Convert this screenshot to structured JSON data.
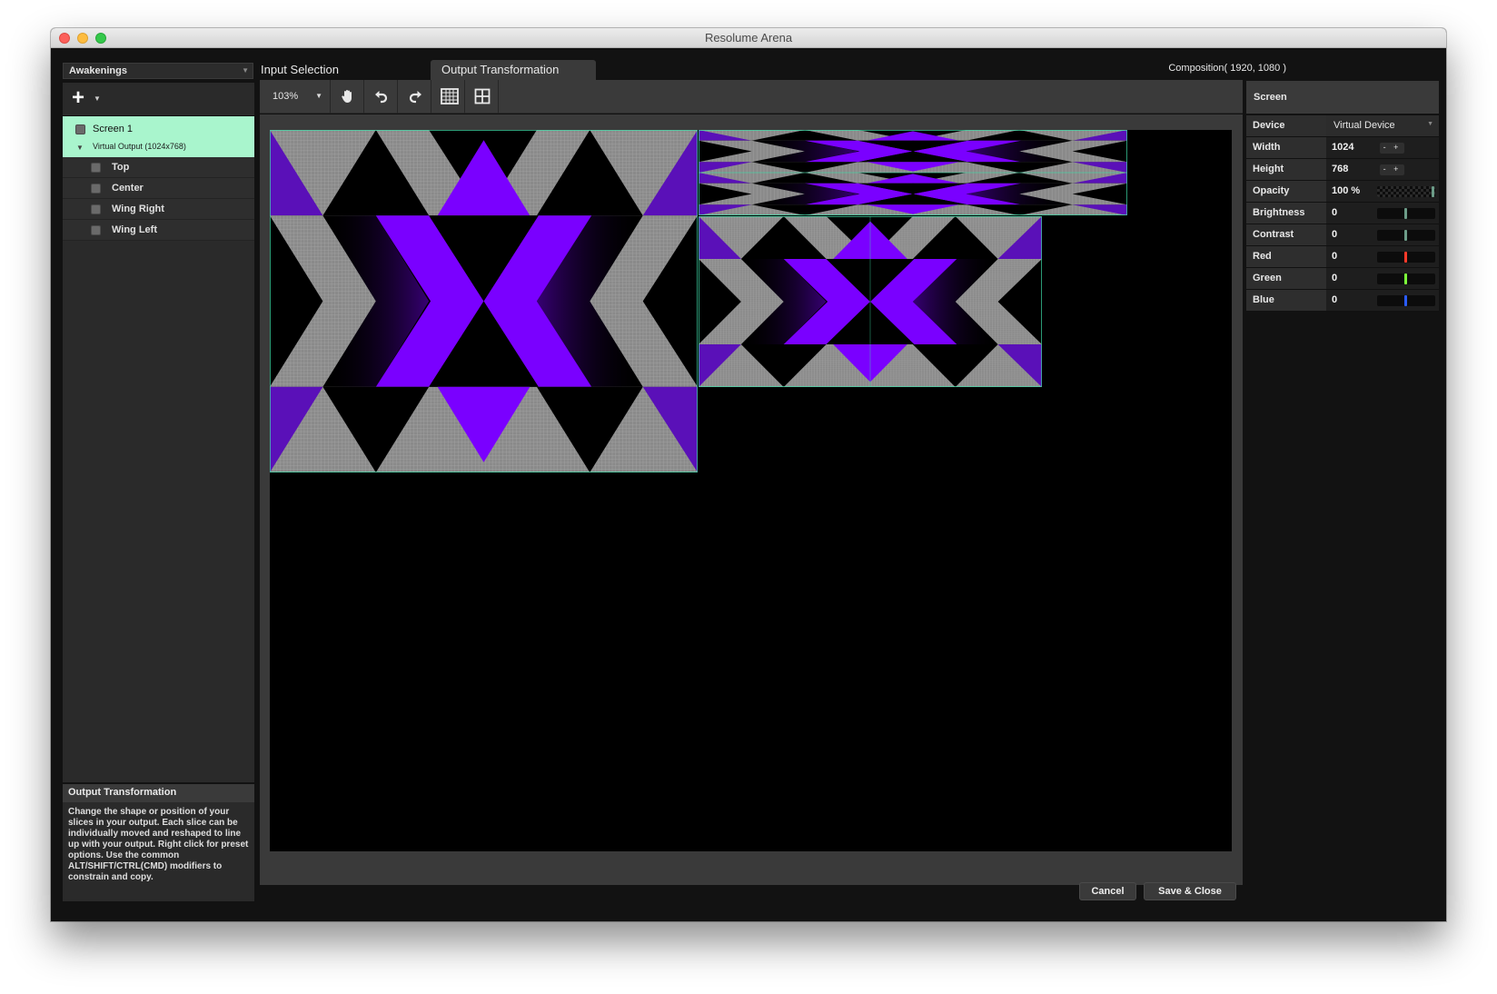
{
  "window": {
    "title": "Resolume Arena"
  },
  "preset": {
    "value": "Awakenings"
  },
  "tree": {
    "screen": {
      "label": "Screen 1",
      "output": "Virtual Output (1024x768)"
    },
    "slices": [
      {
        "label": "Top"
      },
      {
        "label": "Center"
      },
      {
        "label": "Wing Right"
      },
      {
        "label": "Wing Left"
      }
    ]
  },
  "help": {
    "title": "Output Transformation",
    "text": "Change the shape or position of your slices in your output. Each slice can be individually moved and reshaped to line up with your output. Right click for preset options. Use the common ALT/SHIFT/CTRL(CMD) modifiers to constrain and copy."
  },
  "tabs": [
    {
      "label": "Input Selection",
      "active": false
    },
    {
      "label": "Output Transformation",
      "active": true
    }
  ],
  "composition": "Composition( 1920, 1080 )",
  "toolbar": {
    "zoom": "103%",
    "icons": [
      "hand-icon",
      "undo-icon",
      "redo-icon",
      "grid-icon",
      "split-icon"
    ]
  },
  "screen_panel": {
    "title": "Screen",
    "device_label": "Device",
    "device_value": "Virtual Device",
    "width_label": "Width",
    "width_value": "1024",
    "height_label": "Height",
    "height_value": "768",
    "stepper": "- +",
    "opacity_label": "Opacity",
    "opacity_value": "100 %",
    "brightness_label": "Brightness",
    "brightness_value": "0",
    "contrast_label": "Contrast",
    "contrast_value": "0",
    "red_label": "Red",
    "red_value": "0",
    "green_label": "Green",
    "green_value": "0",
    "blue_label": "Blue",
    "blue_value": "0"
  },
  "colors": {
    "accent_selected": "#a9f5cd",
    "purple": "#7a00ff",
    "slice_outline": "#3ddca6",
    "red_knob": "#ff3a2a",
    "green_knob": "#7dff3a",
    "blue_knob": "#2a5cff"
  },
  "buttons": {
    "cancel": "Cancel",
    "save": "Save & Close"
  }
}
